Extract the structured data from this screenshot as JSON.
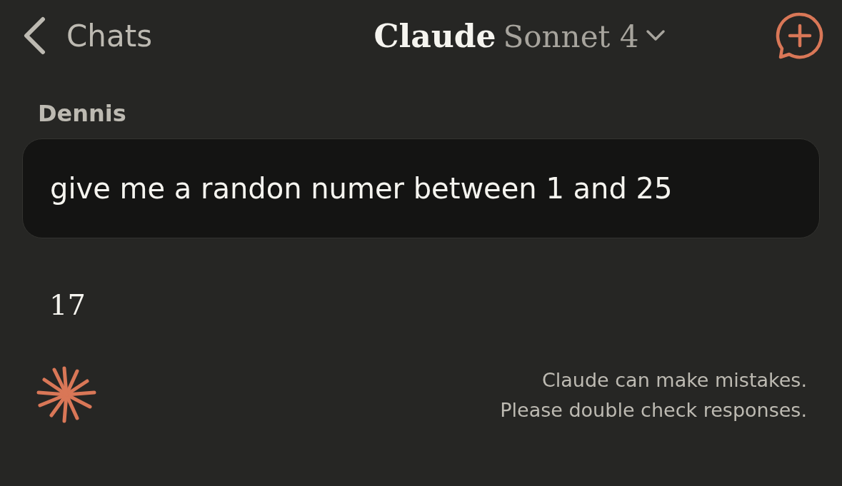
{
  "header": {
    "back_label": "Chats",
    "title": "Claude",
    "model": "Sonnet 4"
  },
  "messages": [
    {
      "kind": "user",
      "author": "Dennis",
      "text": "give me a randon numer between 1 and 25"
    },
    {
      "kind": "assistant",
      "text": "17"
    }
  ],
  "disclaimer": [
    "Claude can make mistakes.",
    "Please double check responses."
  ]
}
